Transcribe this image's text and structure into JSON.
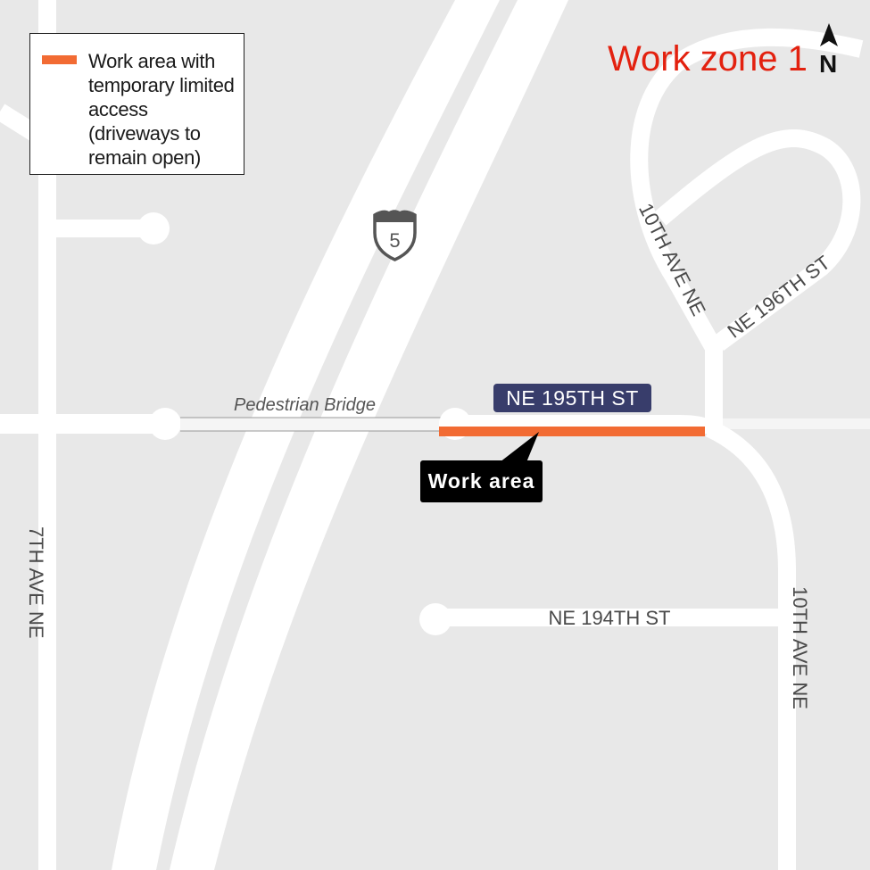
{
  "map": {
    "title": "Work zone 1",
    "title_color": "#e3210f",
    "north_arrow": {
      "icon": "north-arrow-icon",
      "label": "N"
    },
    "legend": {
      "swatch_color": "#f26b33",
      "text": "Work area with temporary limited access (driveways to remain open)"
    },
    "highway_shield": {
      "icon": "interstate-shield-icon",
      "number": "5"
    },
    "streets": {
      "seventh_ave": "7TH AVE NE",
      "tenth_ave_north": "10TH AVE NE",
      "tenth_ave_south": "10TH AVE NE",
      "ne_196th": "NE 196TH ST",
      "ne_195th": "NE 195TH ST",
      "ne_194th": "NE 194TH ST"
    },
    "pedestrian_bridge": "Pedestrian Bridge",
    "callout": "Work area",
    "colors": {
      "background": "#e8e8e8",
      "road": "#ffffff",
      "work_area": "#f26b33",
      "badge": "#383d6b"
    }
  }
}
